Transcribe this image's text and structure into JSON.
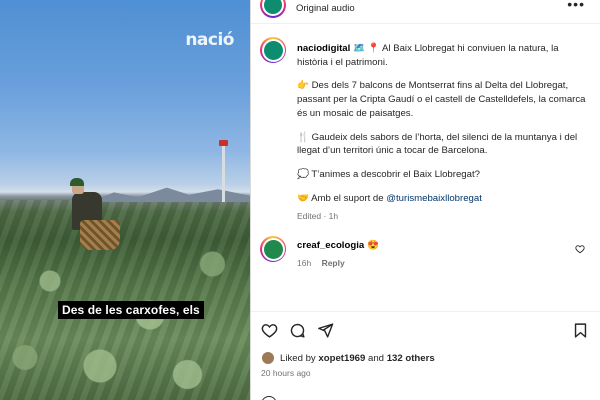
{
  "video": {
    "watermark": "nació",
    "subtitle": "Des de les carxofes, els"
  },
  "header": {
    "audio_label": "Original audio",
    "more_icon": "more-horizontal-icon"
  },
  "post": {
    "username": "naciodigital",
    "line1": "🗺️ 📍 Al Baix Llobregat hi conviuen la natura, la història i el patrimoni.",
    "para2": "👉 Des dels 7 balcons de Montserrat fins al Delta del Llobregat, passant per la Cripta Gaudí o el castell de Castelldefels, la comarca és un mosaic de paisatges.",
    "para3": "🍴 Gaudeix dels sabors de l’horta, del silenci de la muntanya i del llegat d’un territori únic a tocar de Barcelona.",
    "para4": "💭 T’animes a descobrir el Baix Llobregat?",
    "para5_prefix": "🤝 Amb el suport de",
    "mention": "@turismebaixllobregat",
    "edited": "Edited · 1h"
  },
  "comment": {
    "username": "creaf_ecologia",
    "text": "😍",
    "time": "16h",
    "reply": "Reply"
  },
  "actions": {
    "liked_by_prefix": "Liked by",
    "liked_by_user": "xopet1969",
    "and": "and",
    "others": "132 others",
    "time_ago": "20 hours ago"
  },
  "colors": {
    "mention": "#00376b",
    "muted": "#737373",
    "avatar_brand": "#0e8c6f"
  }
}
